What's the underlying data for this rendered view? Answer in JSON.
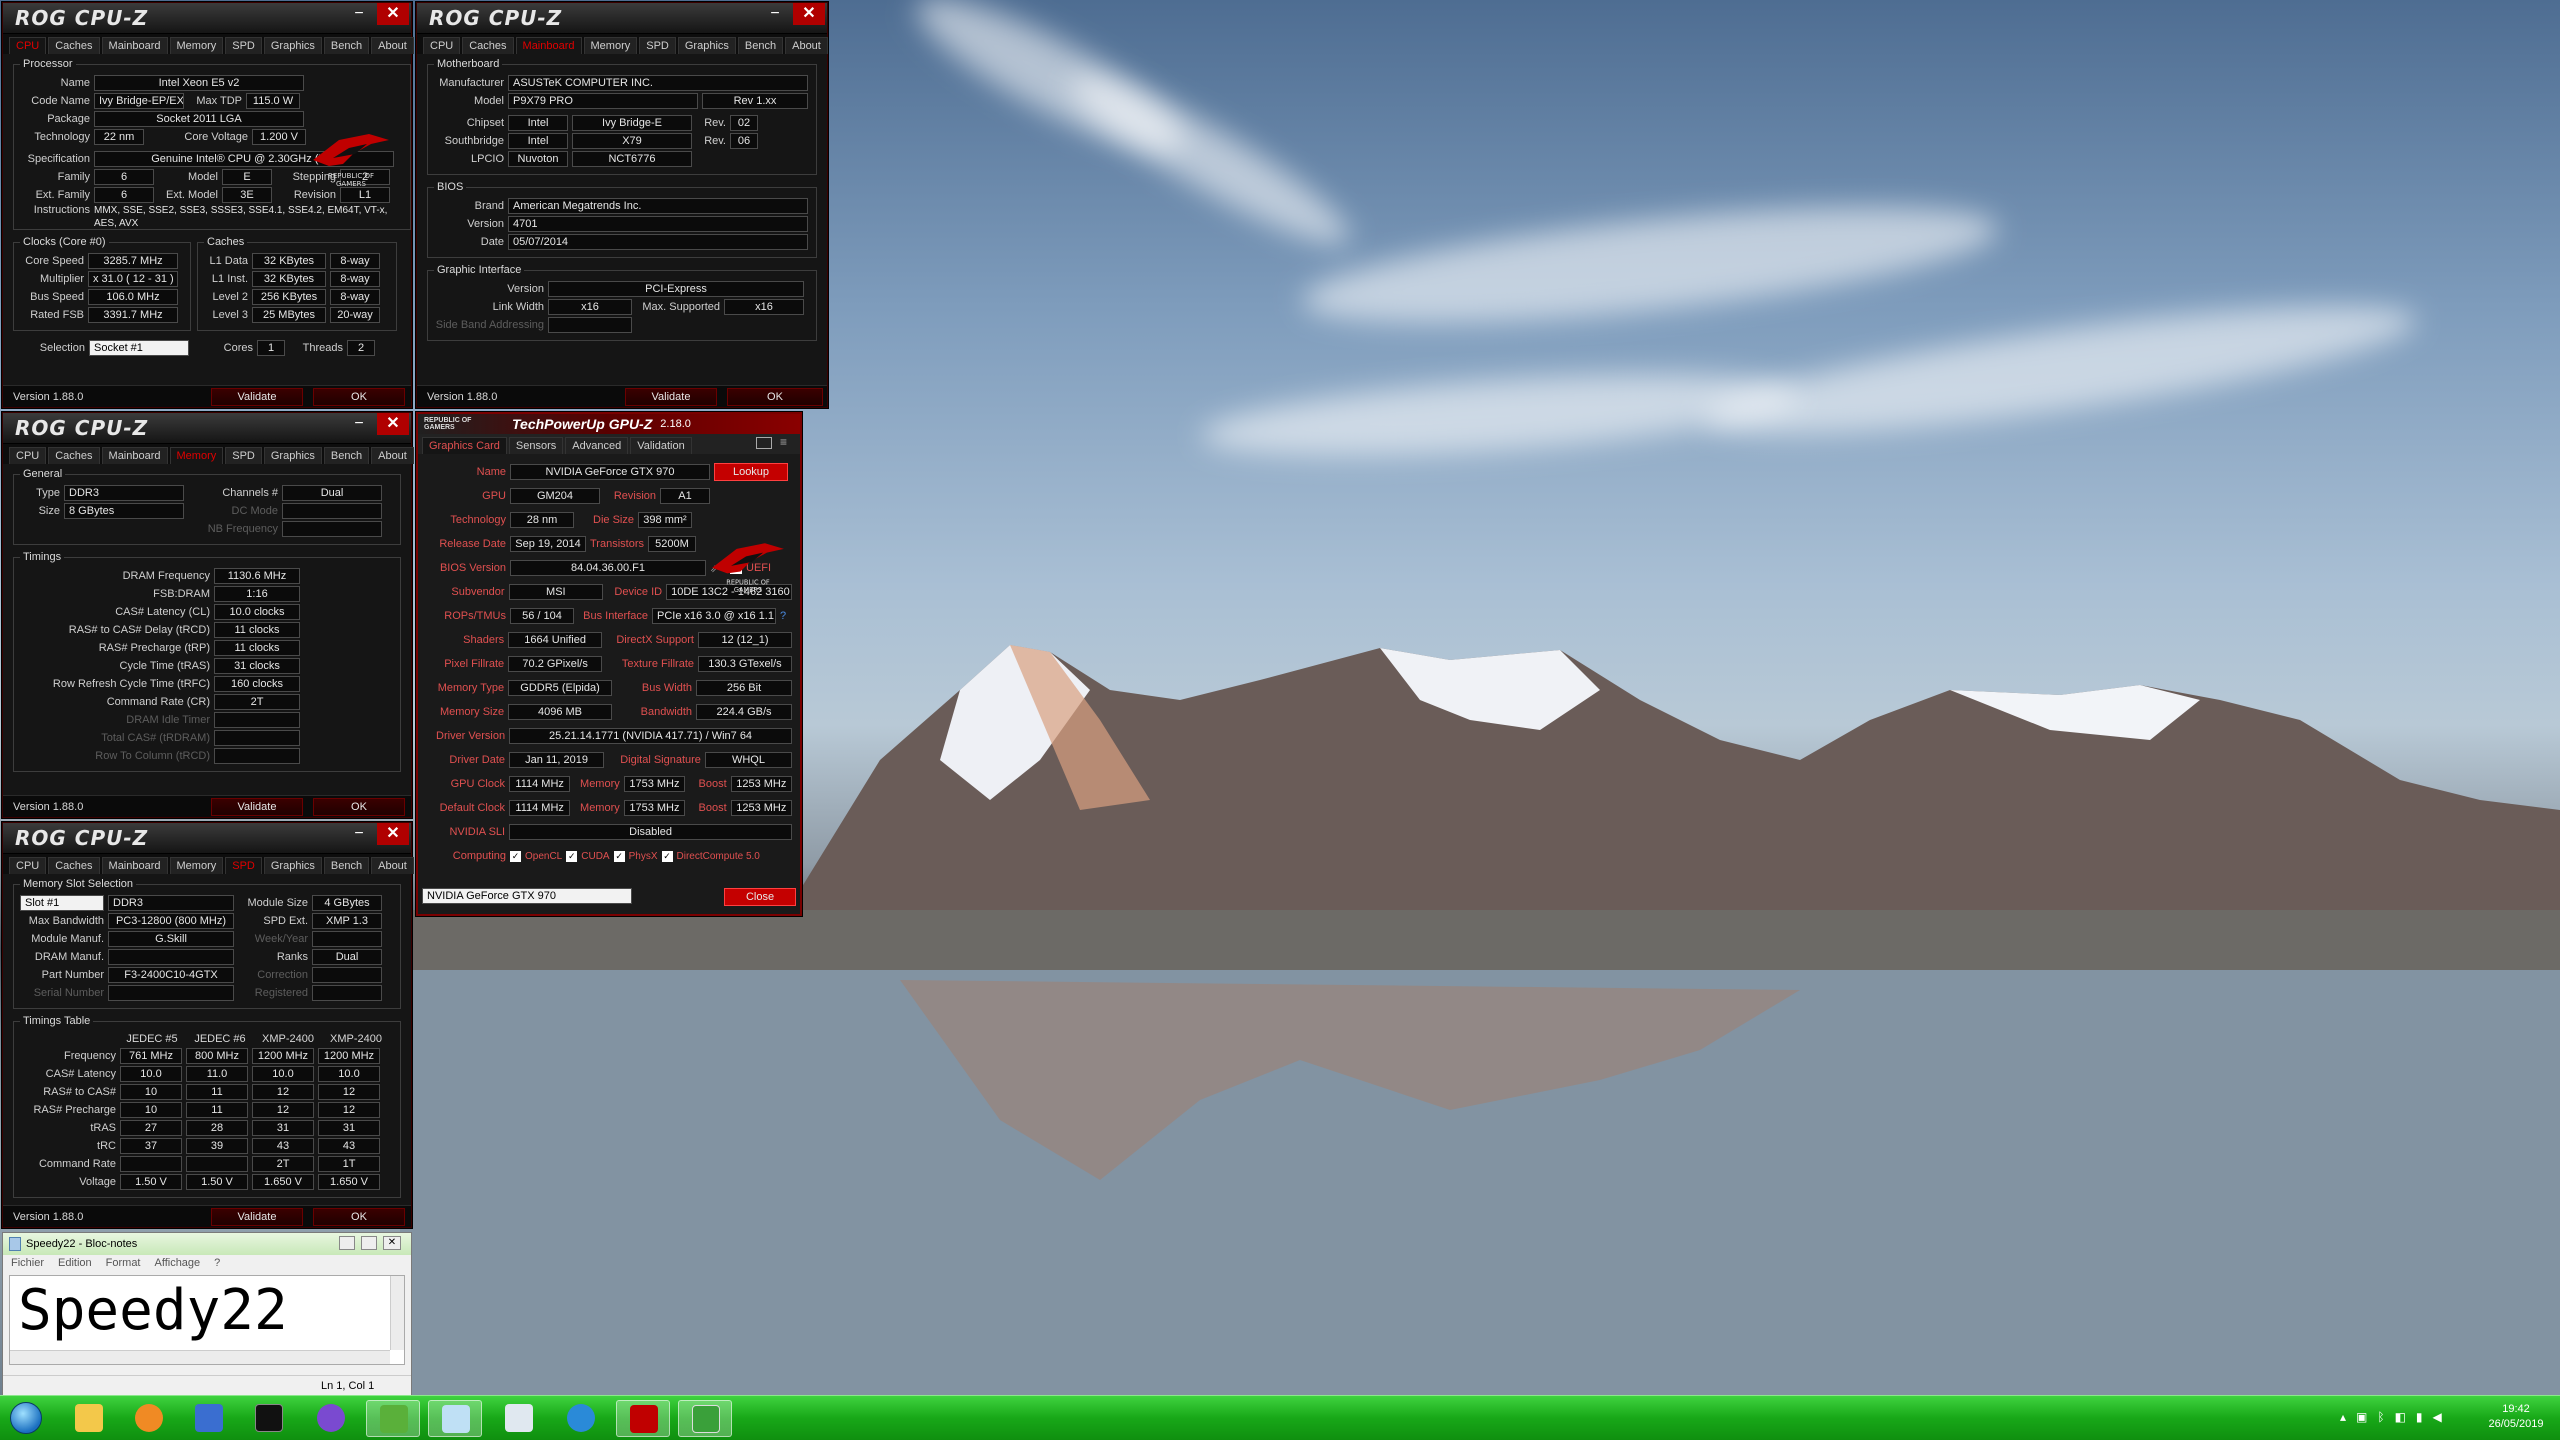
{
  "colors": {
    "rog_red": "#e00000",
    "taskbar": "#1ab01a",
    "gpuz_label": "#e05050"
  },
  "cpuz_common": {
    "logo": "ROG CPU-Z",
    "version": "Version 1.88.0",
    "validate": "Validate",
    "ok": "OK",
    "minimize": "−",
    "close": "✕",
    "tabs": [
      "CPU",
      "Caches",
      "Mainboard",
      "Memory",
      "SPD",
      "Graphics",
      "Bench",
      "About"
    ]
  },
  "cpu": {
    "processor_legend": "Processor",
    "name_l": "Name",
    "name": "Intel Xeon E5 v2",
    "codename_l": "Code Name",
    "codename": "Ivy Bridge-EP/EX",
    "maxtdp_l": "Max TDP",
    "maxtdp": "115.0 W",
    "package_l": "Package",
    "package": "Socket 2011 LGA",
    "tech_l": "Technology",
    "tech": "22 nm",
    "corev_l": "Core Voltage",
    "corev": "1.200 V",
    "spec_l": "Specification",
    "spec": "Genuine Intel® CPU @ 2.30GHz (ES)",
    "family_l": "Family",
    "family": "6",
    "model_l": "Model",
    "model": "E",
    "stepping_l": "Stepping",
    "stepping": "2",
    "extfam_l": "Ext. Family",
    "extfam": "6",
    "extmodel_l": "Ext. Model",
    "extmodel": "3E",
    "revision_l": "Revision",
    "revision": "L1",
    "instr_l": "Instructions",
    "instr": "MMX, SSE, SSE2, SSE3, SSSE3, SSE4.1, SSE4.2, EM64T, VT-x, AES, AVX",
    "clocks_legend": "Clocks (Core #0)",
    "caches_legend": "Caches",
    "corespeed_l": "Core Speed",
    "corespeed": "3285.7 MHz",
    "mult_l": "Multiplier",
    "mult": "x 31.0 ( 12 - 31 )",
    "bus_l": "Bus Speed",
    "bus": "106.0 MHz",
    "fsb_l": "Rated FSB",
    "fsb": "3391.7 MHz",
    "l1d_l": "L1 Data",
    "l1d": "32 KBytes",
    "l1d_w": "8-way",
    "l1i_l": "L1 Inst.",
    "l1i": "32 KBytes",
    "l1i_w": "8-way",
    "l2_l": "Level 2",
    "l2": "256 KBytes",
    "l2_w": "8-way",
    "l3_l": "Level 3",
    "l3": "25 MBytes",
    "l3_w": "20-way",
    "sel_l": "Selection",
    "sel": "Socket #1",
    "cores_l": "Cores",
    "cores": "1",
    "threads_l": "Threads",
    "threads": "2"
  },
  "mb": {
    "legend": "Motherboard",
    "manuf_l": "Manufacturer",
    "manuf": "ASUSTeK COMPUTER INC.",
    "model_l": "Model",
    "model": "P9X79 PRO",
    "rev": "Rev 1.xx",
    "chipset_l": "Chipset",
    "chipset_v": "Intel",
    "chipset": "Ivy Bridge-E",
    "chipset_rev_l": "Rev.",
    "chipset_rev": "02",
    "south_l": "Southbridge",
    "south_v": "Intel",
    "south": "X79",
    "south_rev_l": "Rev.",
    "south_rev": "06",
    "lpcio_l": "LPCIO",
    "lpcio_v": "Nuvoton",
    "lpcio": "NCT6776",
    "bios_legend": "BIOS",
    "brand_l": "Brand",
    "brand": "American Megatrends Inc.",
    "version_l": "Version",
    "version": "4701",
    "date_l": "Date",
    "date": "05/07/2014",
    "gi_legend": "Graphic Interface",
    "giver_l": "Version",
    "giver": "PCI-Express",
    "lw_l": "Link Width",
    "lw": "x16",
    "ms_l": "Max. Supported",
    "ms": "x16",
    "sba_l": "Side Band Addressing"
  },
  "mem": {
    "general_legend": "General",
    "type_l": "Type",
    "type": "DDR3",
    "channels_l": "Channels #",
    "channels": "Dual",
    "size_l": "Size",
    "size": "8 GBytes",
    "dc_l": "DC Mode",
    "nb_l": "NB Frequency",
    "timings_legend": "Timings",
    "rows": [
      {
        "l": "DRAM Frequency",
        "v": "1130.6 MHz",
        "dim": false
      },
      {
        "l": "FSB:DRAM",
        "v": "1:16",
        "dim": false
      },
      {
        "l": "CAS# Latency (CL)",
        "v": "10.0 clocks",
        "dim": false
      },
      {
        "l": "RAS# to CAS# Delay (tRCD)",
        "v": "11 clocks",
        "dim": false
      },
      {
        "l": "RAS# Precharge (tRP)",
        "v": "11 clocks",
        "dim": false
      },
      {
        "l": "Cycle Time (tRAS)",
        "v": "31 clocks",
        "dim": false
      },
      {
        "l": "Row Refresh Cycle Time (tRFC)",
        "v": "160 clocks",
        "dim": false
      },
      {
        "l": "Command Rate (CR)",
        "v": "2T",
        "dim": false
      },
      {
        "l": "DRAM Idle Timer",
        "v": "",
        "dim": true
      },
      {
        "l": "Total CAS# (tRDRAM)",
        "v": "",
        "dim": true
      },
      {
        "l": "Row To Column (tRCD)",
        "v": "",
        "dim": true
      }
    ]
  },
  "spd": {
    "legend": "Memory Slot Selection",
    "slot": "Slot #1",
    "type": "DDR3",
    "modsize_l": "Module Size",
    "modsize": "4 GBytes",
    "maxbw_l": "Max Bandwidth",
    "maxbw": "PC3-12800 (800 MHz)",
    "spdext_l": "SPD Ext.",
    "spdext": "XMP 1.3",
    "modman_l": "Module Manuf.",
    "modman": "G.Skill",
    "week_l": "Week/Year",
    "drman_l": "DRAM Manuf.",
    "ranks_l": "Ranks",
    "ranks": "Dual",
    "part_l": "Part Number",
    "part": "F3-2400C10-4GTX",
    "corr_l": "Correction",
    "serial_l": "Serial Number",
    "reg_l": "Registered",
    "tt_legend": "Timings Table",
    "cols": [
      "JEDEC #5",
      "JEDEC #6",
      "XMP-2400",
      "XMP-2400"
    ],
    "rows": [
      {
        "l": "Frequency",
        "v": [
          "761 MHz",
          "800 MHz",
          "1200 MHz",
          "1200 MHz"
        ]
      },
      {
        "l": "CAS# Latency",
        "v": [
          "10.0",
          "11.0",
          "10.0",
          "10.0"
        ]
      },
      {
        "l": "RAS# to CAS#",
        "v": [
          "10",
          "11",
          "12",
          "12"
        ]
      },
      {
        "l": "RAS# Precharge",
        "v": [
          "10",
          "11",
          "12",
          "12"
        ]
      },
      {
        "l": "tRAS",
        "v": [
          "27",
          "28",
          "31",
          "31"
        ]
      },
      {
        "l": "tRC",
        "v": [
          "37",
          "39",
          "43",
          "43"
        ]
      },
      {
        "l": "Command Rate",
        "v": [
          "",
          "",
          "2T",
          "1T"
        ]
      },
      {
        "l": "Voltage",
        "v": [
          "1.50 V",
          "1.50 V",
          "1.650 V",
          "1.650 V"
        ]
      }
    ]
  },
  "gpuz": {
    "title": "TechPowerUp GPU-Z",
    "ver": "2.18.0",
    "rog_small": "REPUBLIC OF GAMERS",
    "tabs": [
      "Graphics Card",
      "Sensors",
      "Advanced",
      "Validation"
    ],
    "name_l": "Name",
    "name": "NVIDIA GeForce GTX 970",
    "lookup": "Lookup",
    "gpu_l": "GPU",
    "gpu": "GM204",
    "rev_l": "Revision",
    "rev": "A1",
    "tech_l": "Technology",
    "tech": "28 nm",
    "die_l": "Die Size",
    "die": "398 mm²",
    "rel_l": "Release Date",
    "rel": "Sep 19, 2014",
    "trans_l": "Transistors",
    "trans": "5200M",
    "bios_l": "BIOS Version",
    "bios": "84.04.36.00.F1",
    "uefi": "UEFI",
    "subv_l": "Subvendor",
    "subv": "MSI",
    "devid_l": "Device ID",
    "devid": "10DE 13C2 - 1462 3160",
    "rops_l": "ROPs/TMUs",
    "rops": "56 / 104",
    "busif_l": "Bus Interface",
    "busif": "PCIe x16 3.0 @ x16 1.1",
    "q": "?",
    "shaders_l": "Shaders",
    "shaders": "1664 Unified",
    "dx_l": "DirectX Support",
    "dx": "12 (12_1)",
    "pix_l": "Pixel Fillrate",
    "pix": "70.2 GPixel/s",
    "tex_l": "Texture Fillrate",
    "tex": "130.3 GTexel/s",
    "memtype_l": "Memory Type",
    "memtype": "GDDR5 (Elpida)",
    "bw_l": "Bus Width",
    "bw": "256 Bit",
    "memsize_l": "Memory Size",
    "memsize": "4096 MB",
    "bandw_l": "Bandwidth",
    "bandw": "224.4 GB/s",
    "drv_l": "Driver Version",
    "drv": "25.21.14.1771 (NVIDIA 417.71) / Win7 64",
    "drvd_l": "Driver Date",
    "drvd": "Jan 11, 2019",
    "dsig_l": "Digital Signature",
    "dsig": "WHQL",
    "gclk_l": "GPU Clock",
    "gclk": "1114 MHz",
    "mem_l": "Memory",
    "gmem": "1753 MHz",
    "boost_l": "Boost",
    "gboost": "1253 MHz",
    "dclk_l": "Default Clock",
    "dclk": "1114 MHz",
    "dmem": "1753 MHz",
    "dboost": "1253 MHz",
    "sli_l": "NVIDIA SLI",
    "sli": "Disabled",
    "comp_l": "Computing",
    "c1": "OpenCL",
    "c2": "CUDA",
    "c3": "PhysX",
    "c4": "DirectCompute 5.0",
    "select": "NVIDIA GeForce GTX 970",
    "close": "Close"
  },
  "notepad": {
    "title": "Speedy22 - Bloc-notes",
    "menu": [
      "Fichier",
      "Edition",
      "Format",
      "Affichage",
      "?"
    ],
    "text": "Speedy22",
    "status": "Ln 1, Col 1"
  },
  "taskbar": {
    "time": "19:42",
    "date": "26/05/2019",
    "apps": [
      "start-orb",
      "explorer",
      "media-player",
      "network",
      "cmd",
      "cpu-z",
      "gpu-z",
      "notepad",
      "calculator",
      "internet-explorer",
      "rog-cpuz",
      "screen-capture"
    ]
  }
}
